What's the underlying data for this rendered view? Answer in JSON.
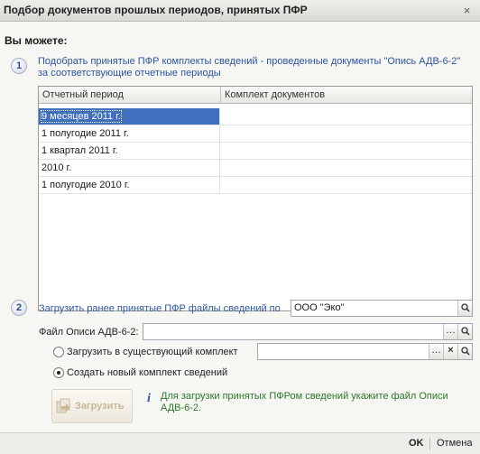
{
  "window": {
    "title": "Подбор документов прошлых периодов, принятых ПФР",
    "close_glyph": "×"
  },
  "heading": "Вы можете:",
  "step1": {
    "number": "1",
    "text_line1": "Подобрать принятые ПФР комплекты сведений - проведенные документы \"Опись АДВ-6-2\"",
    "text_line2": "за соответствующие отчетные периоды"
  },
  "table": {
    "headers": [
      "Отчетный период",
      "Комплект документов"
    ],
    "rows": [
      {
        "period": "9 месяцев 2011 г.",
        "set": ""
      },
      {
        "period": "1 полугодие 2011 г.",
        "set": ""
      },
      {
        "period": "1 квартал 2011 г.",
        "set": ""
      },
      {
        "period": "2010 г.",
        "set": ""
      },
      {
        "period": "1 полугодие 2010 г.",
        "set": ""
      }
    ],
    "selected_row": 0
  },
  "step2": {
    "number": "2",
    "text": "Загрузить ранее принятые ПФР файлы сведений по",
    "org_value": "ООО \"Эко\"",
    "file_label": "Файл Описи АДВ-6-2:",
    "file_value": "",
    "option_existing": "Загрузить в существующий комплект",
    "option_existing_value": "",
    "option_new": "Создать новый комплект сведений",
    "selected_option": "new"
  },
  "load_button": {
    "label": "Загрузить",
    "enabled": false
  },
  "info": {
    "icon": "info-icon",
    "text_line1": "Для загрузки принятых ПФРом сведений укажите файл Описи",
    "text_line2": "АДВ-6-2."
  },
  "footer": {
    "ok_label": "OK",
    "cancel_label": "Отмена"
  },
  "colors": {
    "accent_blue": "#2c55a0",
    "selection": "#3f6fbd",
    "info_green": "#2a7a2a"
  }
}
